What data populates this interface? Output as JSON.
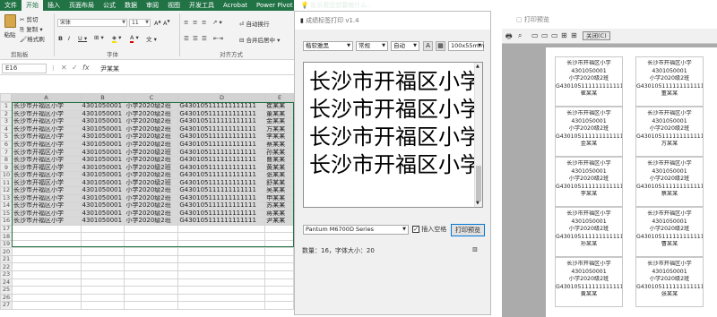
{
  "excel": {
    "tabs": [
      "文件",
      "开始",
      "插入",
      "页面布局",
      "公式",
      "数据",
      "审阅",
      "视图",
      "开发工具",
      "Acrobat",
      "Power Pivot"
    ],
    "active_tab": "开始",
    "tell_me": "告诉我您想要做什么...",
    "clipboard": {
      "paste": "粘贴",
      "cut": "剪切",
      "copy": "复制",
      "format_painter": "格式刷",
      "label": "剪贴板"
    },
    "font": {
      "name": "宋体",
      "size": "11",
      "label": "字体"
    },
    "alignment": {
      "wrap": "自动换行",
      "merge": "合并后居中",
      "label": "对齐方式"
    },
    "name_box": "E16",
    "formula": "尹某某",
    "columns": [
      "A",
      "B",
      "C",
      "D",
      "E"
    ],
    "rows": [
      {
        "n": "1",
        "a": "长沙市开福区小学",
        "b": "4301050001",
        "c": "小学2020级2班",
        "d": "G430105111111111111",
        "e": "崔某某"
      },
      {
        "n": "2",
        "a": "长沙市开福区小学",
        "b": "4301050001",
        "c": "小学2020级2班",
        "d": "G430105111111111111",
        "e": "董某某"
      },
      {
        "n": "3",
        "a": "长沙市开福区小学",
        "b": "4301050001",
        "c": "小学2020级2班",
        "d": "G430105111111111111",
        "e": "金某某"
      },
      {
        "n": "4",
        "a": "长沙市开福区小学",
        "b": "4301050001",
        "c": "小学2020级2班",
        "d": "G430105111111111111",
        "e": "方某某"
      },
      {
        "n": "5",
        "a": "长沙市开福区小学",
        "b": "4301050001",
        "c": "小学2020级2班",
        "d": "G430105111111111111",
        "e": "李某某"
      },
      {
        "n": "6",
        "a": "长沙市开福区小学",
        "b": "4301050001",
        "c": "小学2020级2班",
        "d": "G430105111111111111",
        "e": "蔡某某"
      },
      {
        "n": "7",
        "a": "长沙市开福区小学",
        "b": "4301050001",
        "c": "小学2020级2班",
        "d": "G430105111111111111",
        "e": "孙某某"
      },
      {
        "n": "8",
        "a": "长沙市开福区小学",
        "b": "4301050001",
        "c": "小学2020级2班",
        "d": "G430105111111111111",
        "e": "曹某某"
      },
      {
        "n": "9",
        "a": "长沙市开福区小学",
        "b": "4301050001",
        "c": "小学2020级2班",
        "d": "G430105111111111111",
        "e": "黄某某"
      },
      {
        "n": "10",
        "a": "长沙市开福区小学",
        "b": "4301050001",
        "c": "小学2020级2班",
        "d": "G430105111111111111",
        "e": "张某某"
      },
      {
        "n": "11",
        "a": "长沙市开福区小学",
        "b": "4301050001",
        "c": "小学2020级2班",
        "d": "G430105111111111111",
        "e": "舒某某"
      },
      {
        "n": "12",
        "a": "长沙市开福区小学",
        "b": "4301050001",
        "c": "小学2020级2班",
        "d": "G430105111111111111",
        "e": "吴某某"
      },
      {
        "n": "13",
        "a": "长沙市开福区小学",
        "b": "4301050001",
        "c": "小学2020级2班",
        "d": "G430105111111111111",
        "e": "申某某"
      },
      {
        "n": "14",
        "a": "长沙市开福区小学",
        "b": "4301050001",
        "c": "小学2020级2班",
        "d": "G430105111111111111",
        "e": "苏某某"
      },
      {
        "n": "15",
        "a": "长沙市开福区小学",
        "b": "4301050001",
        "c": "小学2020级2班",
        "d": "G430105111111111111",
        "e": "蒋某某"
      },
      {
        "n": "16",
        "a": "长沙市开福区小学",
        "b": "4301050001",
        "c": "小学2020级2班",
        "d": "G430105111111111111",
        "e": "尹某某"
      },
      {
        "n": "17",
        "a": "",
        "b": "",
        "c": "",
        "d": "",
        "e": ""
      },
      {
        "n": "18",
        "a": "",
        "b": "",
        "c": "",
        "d": "",
        "e": ""
      },
      {
        "n": "19",
        "a": "",
        "b": "",
        "c": "",
        "d": "",
        "e": ""
      },
      {
        "n": "20",
        "a": "",
        "b": "",
        "c": "",
        "d": "",
        "e": ""
      },
      {
        "n": "21",
        "a": "",
        "b": "",
        "c": "",
        "d": "",
        "e": ""
      },
      {
        "n": "22",
        "a": "",
        "b": "",
        "c": "",
        "d": "",
        "e": ""
      },
      {
        "n": "23",
        "a": "",
        "b": "",
        "c": "",
        "d": "",
        "e": ""
      },
      {
        "n": "24",
        "a": "",
        "b": "",
        "c": "",
        "d": "",
        "e": ""
      },
      {
        "n": "25",
        "a": "",
        "b": "",
        "c": "",
        "d": "",
        "e": ""
      },
      {
        "n": "26",
        "a": "",
        "b": "",
        "c": "",
        "d": "",
        "e": ""
      },
      {
        "n": "27",
        "a": "",
        "b": "",
        "c": "",
        "d": "",
        "e": ""
      }
    ]
  },
  "dialog": {
    "title": "成绩标签打印 v1.4",
    "font_select": "楷软雅黑",
    "style_select": "常规",
    "size_select": "自动",
    "btn_a": "A",
    "btn_grid": "▦",
    "paper_select": "100x55mm",
    "lines": [
      "长沙市开福区小学",
      "长沙市开福区小学",
      "长沙市开福区小学",
      "长沙市开福区小学"
    ],
    "printer": "Pantum M6700D Series",
    "insert_blank": "插入空格",
    "print_preview": "打印预览",
    "status": "数量：16，字体大小：20"
  },
  "preview": {
    "title": "打印预览",
    "close": "关闭(C)",
    "labels": [
      {
        "school": "长沙市开福区小学",
        "code": "4301050001",
        "cls": "小学2020级2班",
        "id": "G430105111111111111",
        "name": "崔某某"
      },
      {
        "school": "长沙市开福区小学",
        "code": "4301050001",
        "cls": "小学2020级2班",
        "id": "G430105111111111111",
        "name": "董某某"
      },
      {
        "school": "长沙市开福区小学",
        "code": "4301050001",
        "cls": "小学2020级2班",
        "id": "G430105111111111111",
        "name": "金某某"
      },
      {
        "school": "长沙市开福区小学",
        "code": "4301050001",
        "cls": "小学2020级2班",
        "id": "G430105111111111111",
        "name": "方某某"
      },
      {
        "school": "长沙市开福区小学",
        "code": "4301050001",
        "cls": "小学2020级2班",
        "id": "G430105111111111111",
        "name": "李某某"
      },
      {
        "school": "长沙市开福区小学",
        "code": "4301050001",
        "cls": "小学2020级2班",
        "id": "G430105111111111111",
        "name": "蔡某某"
      },
      {
        "school": "长沙市开福区小学",
        "code": "4301050001",
        "cls": "小学2020级2班",
        "id": "G430105111111111111",
        "name": "孙某某"
      },
      {
        "school": "长沙市开福区小学",
        "code": "4301050001",
        "cls": "小学2020级2班",
        "id": "G430105111111111111",
        "name": "曹某某"
      },
      {
        "school": "长沙市开福区小学",
        "code": "4301050001",
        "cls": "小学2020级2班",
        "id": "G430105111111111111",
        "name": "黄某某"
      },
      {
        "school": "长沙市开福区小学",
        "code": "4301050001",
        "cls": "小学2020级2班",
        "id": "G430105111111111111",
        "name": "张某某"
      }
    ]
  }
}
